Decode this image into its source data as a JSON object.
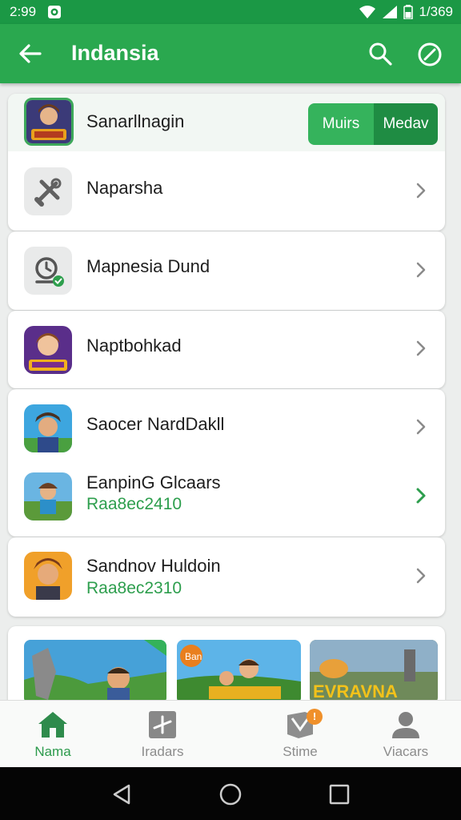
{
  "status_bar": {
    "time": "2:99",
    "battery_text": "1/369"
  },
  "app_bar": {
    "title": "Indansia"
  },
  "list": {
    "header": {
      "label": "Sanarllnagin",
      "segment_left": "Muirs",
      "segment_right": "Medav"
    },
    "items": [
      {
        "label": "Naparsha",
        "icon": "tools-icon"
      },
      {
        "label": "Mapnesia Dund",
        "icon": "timer-check-icon"
      },
      {
        "label": "Naptbohkad",
        "icon": "game-character-icon"
      },
      {
        "label": "Saocer NardDakll",
        "icon": "game-character-icon"
      },
      {
        "label": "EanpinG Glcaars",
        "sub": "Raa8ec2410",
        "icon": "game-character-icon"
      },
      {
        "label": "Sandnov Huldoin",
        "sub": "Raa8ec2310",
        "icon": "game-character-icon"
      }
    ]
  },
  "banners": {
    "card2_text": "Ban",
    "card3_text": "EVRAVNA"
  },
  "bottom_nav": [
    {
      "label": "Nama",
      "icon": "home-icon",
      "active": true
    },
    {
      "label": "Iradars",
      "icon": "cross-box-icon",
      "active": false
    },
    {
      "label": "Stime",
      "icon": "shield-icon",
      "active": false,
      "badge": "!"
    },
    {
      "label": "Viacars",
      "icon": "person-icon",
      "active": false
    }
  ],
  "colors": {
    "primary": "#2aa84f",
    "status": "#1b9845",
    "accent_text": "#2d9e4d"
  }
}
